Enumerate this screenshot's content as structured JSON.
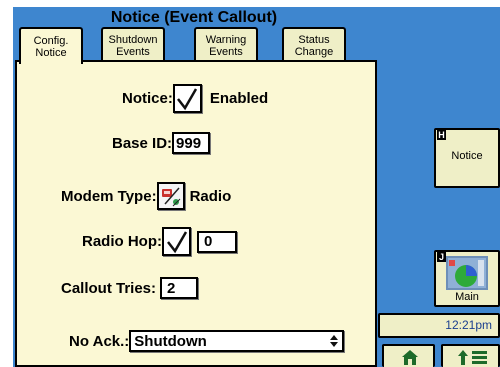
{
  "window": {
    "title": "Notice (Event Callout)"
  },
  "tabs": [
    {
      "label": "Config.\nNotice",
      "active": true
    },
    {
      "label": "Shutdown\nEvents",
      "active": false
    },
    {
      "label": "Warning\nEvents",
      "active": false
    },
    {
      "label": "Status\nChange",
      "active": false
    }
  ],
  "form": {
    "notice": {
      "label": "Notice:",
      "value": "Enabled",
      "checked": true
    },
    "base_id": {
      "label": "Base ID:",
      "value": "999"
    },
    "modem_type": {
      "label": "Modem Type:",
      "value": "Radio",
      "icon": "radio-modem-icon"
    },
    "radio_hop": {
      "label": "Radio Hop:",
      "checked": true,
      "value": "0"
    },
    "callout_tries": {
      "label": "Callout Tries:",
      "value": "2"
    },
    "no_ack": {
      "label": "No Ack.:",
      "value": "Shutdown"
    }
  },
  "sidebar": {
    "notice_button": {
      "key": "H",
      "label": "Notice"
    },
    "main_button": {
      "key": "J",
      "label": "Main",
      "icon": "gauge-map-icon"
    },
    "clock": "12:21pm",
    "home_button": {
      "icon": "home-icon"
    },
    "menu_button": {
      "icon": "up-arrow-menu-icon"
    }
  },
  "colors": {
    "background": "#3e86cf",
    "panel": "#fbf8d4",
    "tab": "#efefc7",
    "button": "#efefc7",
    "clock_text": "#1a3f8f"
  }
}
